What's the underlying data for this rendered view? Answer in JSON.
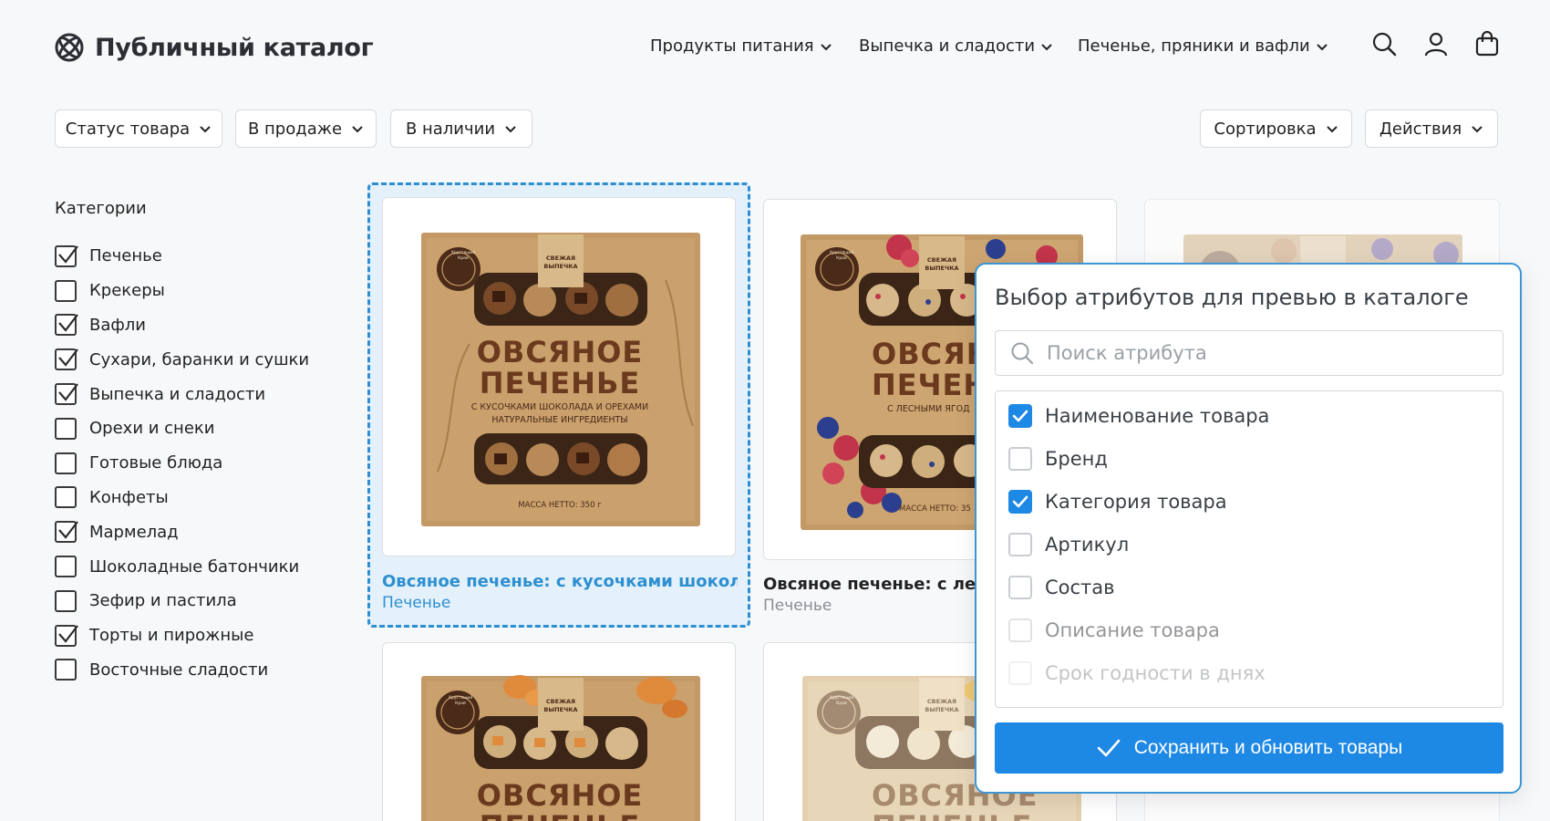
{
  "header": {
    "title": "Публичный каталог",
    "nav": [
      "Продукты питания",
      "Выпечка и сладости",
      "Печенье, пряники и вафли"
    ]
  },
  "filters": {
    "status": "Статус товара",
    "sale": "В продаже",
    "stock": "В наличии",
    "sort": "Сортировка",
    "actions": "Действия"
  },
  "sidebar": {
    "title": "Категории",
    "items": [
      {
        "label": "Печенье",
        "checked": true
      },
      {
        "label": "Крекеры",
        "checked": false
      },
      {
        "label": "Вафли",
        "checked": true
      },
      {
        "label": "Сухари, баранки и сушки",
        "checked": true
      },
      {
        "label": "Выпечка и сладости",
        "checked": true
      },
      {
        "label": "Орехи и снеки",
        "checked": false
      },
      {
        "label": "Готовые блюда",
        "checked": false
      },
      {
        "label": "Конфеты",
        "checked": false
      },
      {
        "label": "Мармелад",
        "checked": true
      },
      {
        "label": "Шоколадные батончики",
        "checked": false
      },
      {
        "label": "Зефир и пастила",
        "checked": false
      },
      {
        "label": "Торты и пирожные",
        "checked": true
      },
      {
        "label": "Восточные сладости",
        "checked": false
      }
    ]
  },
  "products": [
    {
      "name": "Овсяное печенье: с кусочками шоколад...",
      "category": "Печенье",
      "pack": {
        "brand": "Хрустящий Край",
        "badge": "СВЕЖАЯ ВЫПЕЧКА",
        "line1": "ОВСЯНОЕ",
        "line2": "ПЕЧЕНЬЕ",
        "sub1": "С КУСОЧКАМИ ШОКОЛАДА И ОРЕХАМИ",
        "sub2": "НАТУРАЛЬНЫЕ ИНГРЕДИЕНТЫ",
        "mass": "МАССА НЕТТО: 350 г"
      }
    },
    {
      "name": "Овсяное печенье: с лесны",
      "category": "Печенье",
      "pack": {
        "brand": "Хрустящий Край",
        "badge": "СВЕЖАЯ ВЫПЕЧКА",
        "line1": "ОВСЯН",
        "line2": "ПЕЧЕН",
        "sub1": "С ЛЕСНЫМИ ЯГОД",
        "mass": "МАССА НЕТТО: 35"
      }
    },
    {
      "pack": {
        "brand": "Хрустящий Край",
        "badge": "СВЕЖАЯ ВЫПЕЧКА",
        "line1": "ОВСЯНОЕ",
        "line2": "ПЕЧЕНЬЕ"
      }
    },
    {
      "pack": {
        "brand": "Хрустящий Край",
        "badge": "СВЕЖАЯ ВЫПЕЧКА",
        "line1": "ОВСЯНОЕ",
        "line2": "ПЕЧЕНЬЕ"
      }
    }
  ],
  "popup": {
    "title": "Выбор атрибутов для превью в каталоге",
    "search_placeholder": "Поиск атрибута",
    "attributes": [
      {
        "label": "Наименование товара",
        "checked": true
      },
      {
        "label": "Бренд",
        "checked": false
      },
      {
        "label": "Категория товара",
        "checked": true
      },
      {
        "label": "Артикул",
        "checked": false
      },
      {
        "label": "Состав",
        "checked": false
      },
      {
        "label": "Описание товара",
        "checked": false
      },
      {
        "label": "Срок годности в днях",
        "checked": false
      }
    ],
    "save_label": "Сохранить и обновить товары"
  },
  "colors": {
    "accent": "#1e88e5",
    "selected_text": "#2d8fd1",
    "kraft": "#c39a66",
    "brown_text": "#6b3a1e"
  }
}
